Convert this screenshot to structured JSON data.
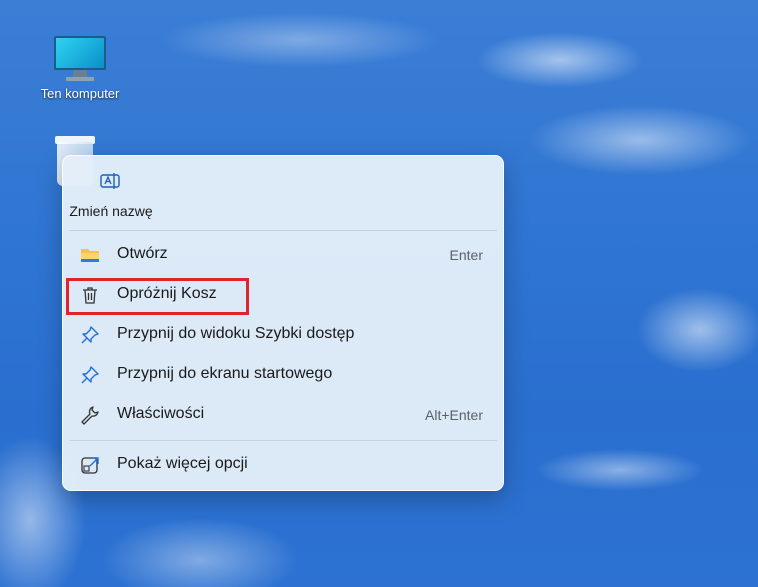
{
  "desktop": {
    "icons": [
      {
        "label": "Ten komputer"
      },
      {
        "label": ""
      }
    ]
  },
  "context_menu": {
    "quick_action": {
      "label": "Zmień nazwę",
      "icon": "rename-icon"
    },
    "items": [
      {
        "label": "Otwórz",
        "shortcut": "Enter",
        "icon": "folder-icon"
      },
      {
        "label": "Opróżnij Kosz",
        "shortcut": "",
        "icon": "trash-icon"
      },
      {
        "label": "Przypnij do widoku Szybki dostęp",
        "shortcut": "",
        "icon": "pin-icon"
      },
      {
        "label": "Przypnij do ekranu startowego",
        "shortcut": "",
        "icon": "pin-icon"
      },
      {
        "label": "Właściwości",
        "shortcut": "Alt+Enter",
        "icon": "wrench-icon"
      },
      {
        "label": "Pokaż więcej opcji",
        "shortcut": "",
        "icon": "expand-icon"
      }
    ],
    "highlighted_item": "Opróżnij Kosz"
  },
  "colors": {
    "highlight": "#e0242b",
    "accent_pin": "#1f6fd6",
    "folder": "#f5c242"
  }
}
